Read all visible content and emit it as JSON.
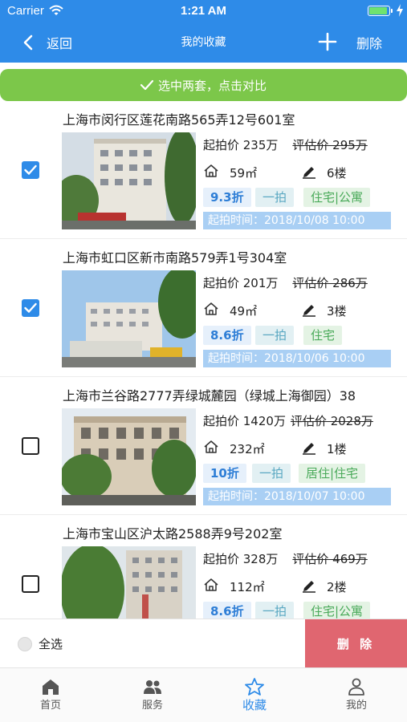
{
  "status_bar": {
    "carrier": "Carrier",
    "time": "1:21 AM",
    "battery_level": 0.95
  },
  "nav": {
    "back_label": "返回",
    "title": "我的收藏",
    "delete_label": "删除"
  },
  "compare_banner": {
    "text": "选中两套，点击对比"
  },
  "listings": [
    {
      "title": "上海市闵行区莲花南路565弄12号601室",
      "checked": true,
      "start_price": "起拍价 235万",
      "eval_price": "评估价 295万",
      "area": "59㎡",
      "floor": "6楼",
      "discount": "9.3折",
      "auction": "一拍",
      "type": "住宅|公寓",
      "start_time": "起拍时间：2018/10/08 10:00"
    },
    {
      "title": "上海市虹口区新市南路579弄1号304室",
      "checked": true,
      "start_price": "起拍价 201万",
      "eval_price": "评估价 286万",
      "area": "49㎡",
      "floor": "3楼",
      "discount": "8.6折",
      "auction": "一拍",
      "type": "住宅",
      "start_time": "起拍时间：2018/10/06 10:00"
    },
    {
      "title": "上海市兰谷路2777弄绿城麓园（绿城上海御园）38",
      "checked": false,
      "start_price": "起拍价 1420万",
      "eval_price": "评估价 2028万",
      "area": "232㎡",
      "floor": "1楼",
      "discount": "10折",
      "auction": "一拍",
      "type": "居住|住宅",
      "start_time": "起拍时间：2018/10/07 10:00"
    },
    {
      "title": "上海市宝山区沪太路2588弄9号202室",
      "checked": false,
      "start_price": "起拍价 328万",
      "eval_price": "评估价 469万",
      "area": "112㎡",
      "floor": "2楼",
      "discount": "8.6折",
      "auction": "一拍",
      "type": "住宅|公寓",
      "start_time": ""
    }
  ],
  "footer": {
    "select_all_label": "全选",
    "delete_button_label": "删 除"
  },
  "tabs": [
    {
      "label": "首页",
      "icon": "home-icon",
      "active": false
    },
    {
      "label": "服务",
      "icon": "people-icon",
      "active": false
    },
    {
      "label": "收藏",
      "icon": "star-icon",
      "active": true
    },
    {
      "label": "我的",
      "icon": "person-icon",
      "active": false
    }
  ],
  "colors": {
    "primary": "#2e8be8",
    "compare_green": "#7cc74a",
    "delete_red": "#e06670",
    "tag_blue_bg": "#e6f0fb",
    "tag_green_bg": "#e4f3e4",
    "time_bar": "#a9cff4"
  }
}
